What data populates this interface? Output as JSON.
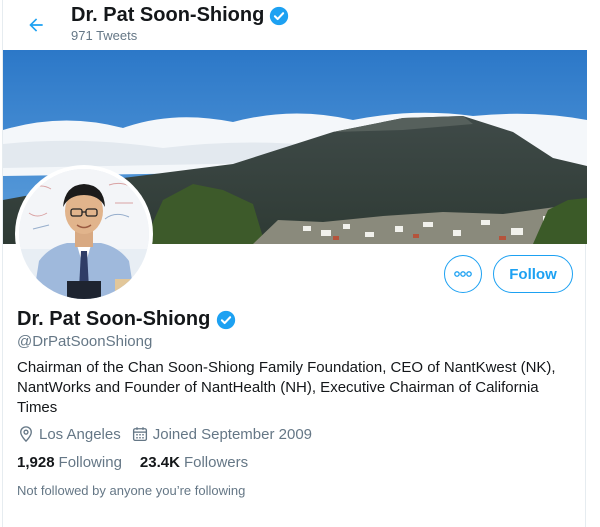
{
  "header": {
    "name": "Dr. Pat Soon-Shiong",
    "tweet_count": "971 Tweets"
  },
  "actions": {
    "follow_label": "Follow"
  },
  "profile": {
    "name": "Dr. Pat Soon-Shiong",
    "handle": "@DrPatSoonShiong",
    "bio": "Chairman of the Chan Soon-Shiong Family Foundation, CEO of NantKwest (NK), NantWorks and Founder of NantHealth (NH), Executive Chairman of California Times",
    "location": "Los Angeles",
    "joined": "Joined September 2009",
    "following_count": "1,928",
    "following_label": "Following",
    "followers_count": "23.4K",
    "followers_label": "Followers",
    "not_followed": "Not followed by anyone you’re following"
  },
  "icons": {
    "back": "arrow-left-icon",
    "verified": "verified-badge-icon",
    "more": "more-dots-icon",
    "location": "location-pin-icon",
    "calendar": "calendar-icon"
  },
  "colors": {
    "accent": "#1da1f2",
    "secondary_text": "#657786",
    "primary_text": "#14171a"
  }
}
